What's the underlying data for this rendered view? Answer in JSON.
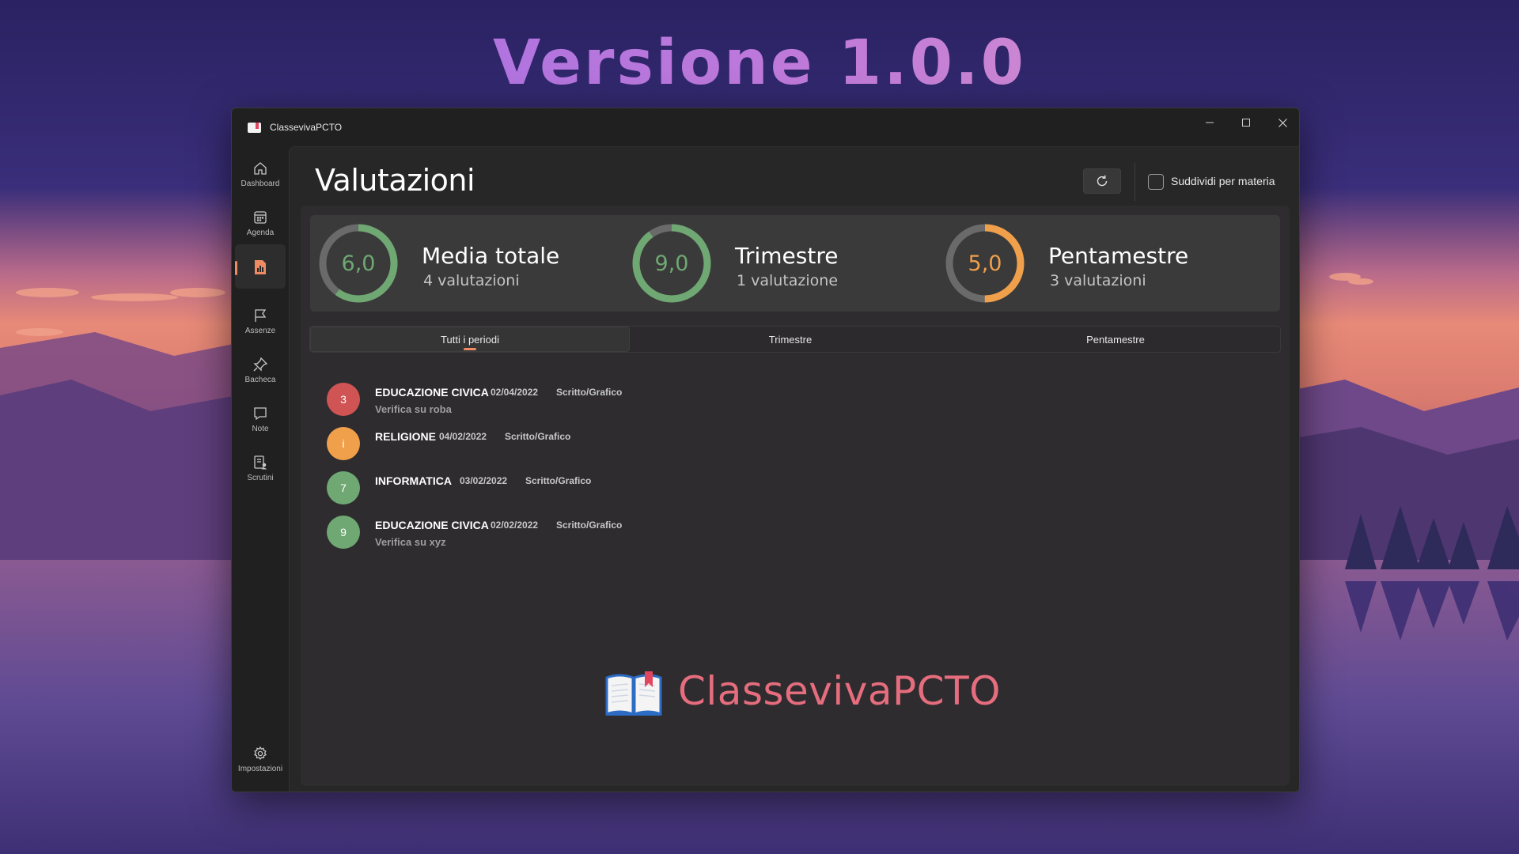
{
  "headline": "Versione 1.0.0",
  "window": {
    "title": "ClassevivaPCTO",
    "controls": {
      "minimize": "minimize-icon",
      "maximize": "maximize-icon",
      "close": "close-icon"
    }
  },
  "sidebar": {
    "items": [
      {
        "label": "Dashboard",
        "icon": "home-icon"
      },
      {
        "label": "Agenda",
        "icon": "calendar-icon"
      },
      {
        "label": "",
        "icon": "grades-document-icon",
        "active": true
      },
      {
        "label": "Assenze",
        "icon": "flag-icon"
      },
      {
        "label": "Bacheca",
        "icon": "pin-icon"
      },
      {
        "label": "Note",
        "icon": "note-icon"
      },
      {
        "label": "Scrutini",
        "icon": "report-card-icon"
      }
    ],
    "settings": {
      "label": "Impostazioni",
      "icon": "gear-icon"
    }
  },
  "page": {
    "title": "Valutazioni",
    "refresh_icon": "refresh-icon",
    "split_by_subject_label": "Suddividi per materia",
    "split_by_subject_checked": false
  },
  "stats": [
    {
      "value": "6,0",
      "title": "Media totale",
      "subtitle": "4 valutazioni",
      "fraction": 0.6,
      "color": "#6fa873"
    },
    {
      "value": "9,0",
      "title": "Trimestre",
      "subtitle": "1 valutazione",
      "fraction": 0.9,
      "color": "#6fa873"
    },
    {
      "value": "5,0",
      "title": "Pentamestre",
      "subtitle": "3 valutazioni",
      "fraction": 0.5,
      "color": "#f0a04b"
    }
  ],
  "tabs": [
    {
      "label": "Tutti i periodi",
      "selected": true
    },
    {
      "label": "Trimestre",
      "selected": false
    },
    {
      "label": "Pentamestre",
      "selected": false
    }
  ],
  "grades": [
    {
      "grade": "3",
      "subject": "EDUCAZIONE CIVICA",
      "date": "02/04/2022",
      "type": "Scritto/Grafico",
      "description": "Verifica su roba",
      "color": "#d05454"
    },
    {
      "grade": "i",
      "subject": "RELIGIONE",
      "date": "04/02/2022",
      "type": "Scritto/Grafico",
      "description": "",
      "color": "#f0a04b"
    },
    {
      "grade": "7",
      "subject": "INFORMATICA",
      "date": "03/02/2022",
      "type": "Scritto/Grafico",
      "description": "",
      "color": "#6fa873"
    },
    {
      "grade": "9",
      "subject": "EDUCAZIONE CIVICA",
      "date": "02/02/2022",
      "type": "Scritto/Grafico",
      "description": "Verifica su xyz",
      "color": "#6fa873"
    }
  ],
  "brand": {
    "icon": "open-book-icon",
    "text": "ClassevivaPCTO"
  },
  "colors": {
    "accent": "#ef8b63",
    "green": "#6fa873",
    "orange": "#f0a04b",
    "red": "#d05454"
  }
}
